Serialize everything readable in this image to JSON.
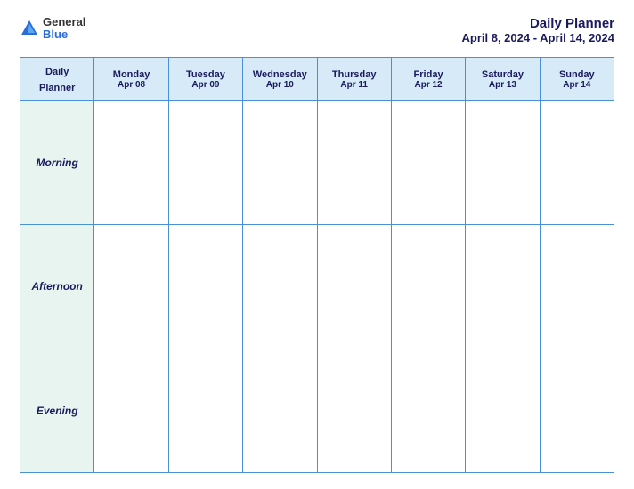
{
  "logo": {
    "general": "General",
    "blue": "Blue"
  },
  "title": {
    "main": "Daily Planner",
    "date_range": "April 8, 2024 - April 14, 2024"
  },
  "table": {
    "first_col_header": [
      "Daily",
      "Planner"
    ],
    "columns": [
      {
        "day": "Monday",
        "date": "Apr 08"
      },
      {
        "day": "Tuesday",
        "date": "Apr 09"
      },
      {
        "day": "Wednesday",
        "date": "Apr 10"
      },
      {
        "day": "Thursday",
        "date": "Apr 11"
      },
      {
        "day": "Friday",
        "date": "Apr 12"
      },
      {
        "day": "Saturday",
        "date": "Apr 13"
      },
      {
        "day": "Sunday",
        "date": "Apr 14"
      }
    ],
    "rows": [
      {
        "label": "Morning"
      },
      {
        "label": "Afternoon"
      },
      {
        "label": "Evening"
      }
    ]
  }
}
